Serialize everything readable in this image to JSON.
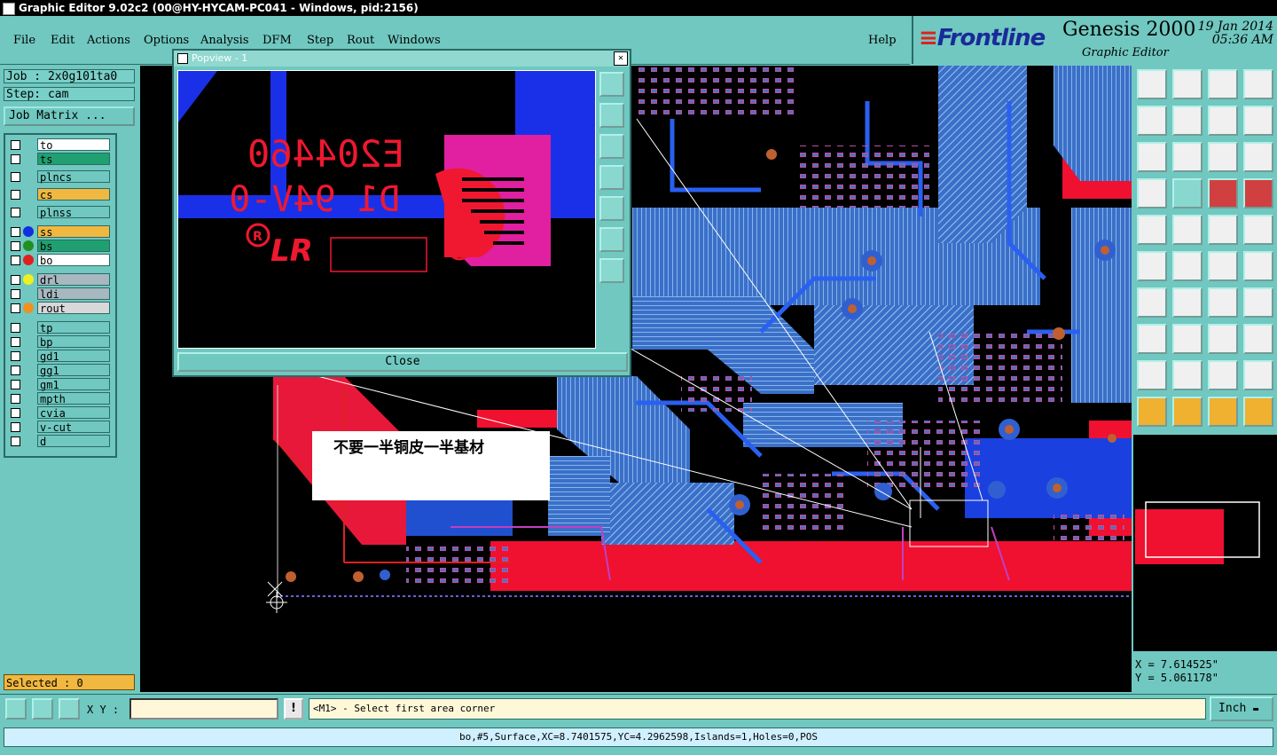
{
  "window": {
    "title": "Graphic Editor 9.02c2 (00@HY-HYCAM-PC041 - Windows, pid:2156)"
  },
  "menu": [
    "File",
    "Edit",
    "Actions",
    "Options",
    "Analysis",
    "DFM",
    "Step",
    "Rout",
    "Windows"
  ],
  "help_label": "Help",
  "brand": {
    "logo": "Frontline",
    "product": "Genesis 2000",
    "subtitle": "Graphic Editor",
    "date": "19 Jan 2014",
    "time": "05:36 AM"
  },
  "job": {
    "job_label": "Job : 2x0g101ta0",
    "step_label": "Step: cam",
    "matrix_button": "Job Matrix ..."
  },
  "layers": [
    {
      "name": "to",
      "color": "#ffffff",
      "dot": ""
    },
    {
      "name": "ts",
      "color": "#20a070",
      "dot": ""
    },
    {
      "name": "plncs",
      "color": "#70c8c0",
      "dot": ""
    },
    {
      "name": "cs",
      "color": "#f0b840",
      "dot": ""
    },
    {
      "name": "plnss",
      "color": "#70c8c0",
      "dot": ""
    },
    {
      "name": "ss",
      "color": "#f0b840",
      "dot": "#1030e0"
    },
    {
      "name": "bs",
      "color": "#20a070",
      "dot": "#209020"
    },
    {
      "name": "bo",
      "color": "#ffffff",
      "dot": "#e02020"
    },
    {
      "name": "drl",
      "color": "#a8b8c0",
      "dot": "#f0f020"
    },
    {
      "name": "ldi",
      "color": "#a8b8c0",
      "dot": ""
    },
    {
      "name": "rout",
      "color": "#d8d8d8",
      "dot": "#f09020"
    },
    {
      "name": "tp",
      "color": "#70c8c0",
      "dot": ""
    },
    {
      "name": "bp",
      "color": "#70c8c0",
      "dot": ""
    },
    {
      "name": "gd1",
      "color": "#70c8c0",
      "dot": ""
    },
    {
      "name": "gg1",
      "color": "#70c8c0",
      "dot": ""
    },
    {
      "name": "gm1",
      "color": "#70c8c0",
      "dot": ""
    },
    {
      "name": "mpth",
      "color": "#70c8c0",
      "dot": ""
    },
    {
      "name": "cvia",
      "color": "#70c8c0",
      "dot": ""
    },
    {
      "name": "v-cut",
      "color": "#70c8c0",
      "dot": ""
    },
    {
      "name": "d",
      "color": "#70c8c0",
      "dot": ""
    }
  ],
  "selected_label": "Selected : 0",
  "popview": {
    "title": "Popview - 1",
    "close_label": "Close",
    "text_line1": "E204460",
    "text_line2": "D1 94V-0",
    "logo_text": "LR"
  },
  "annotation_text": "不要一半铜皮一半基材",
  "toolbar": {
    "xy_label": "X Y :",
    "xy_value": "",
    "warn_symbol": "!",
    "prompt": "<M1> - Select first area corner",
    "unit": "Inch"
  },
  "coords": {
    "x_label": "X =  7.614525\"",
    "y_label": "Y =  5.061178\""
  },
  "status": "bo,#5,Surface,XC=8.7401575,YC=4.2962598,Islands=1,Holes=0,POS",
  "colors": {
    "panel": "#70c8c0",
    "copper_blue": "#4a8ae0",
    "copper_red": "#f01030",
    "pad_magenta": "#e040c0"
  }
}
